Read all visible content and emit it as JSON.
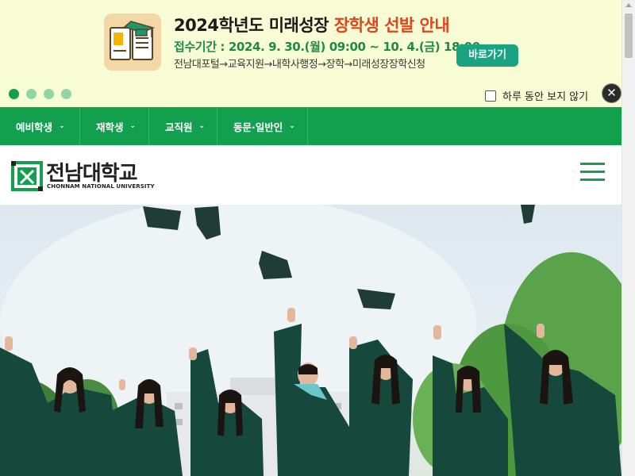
{
  "popup": {
    "title_prefix": "2024학년도 미래성장 ",
    "title_highlight": "장학생 선발 안내",
    "period": "접수기간 : 2024. 9. 30.(월) 09:00 ~  10. 4.(금) 18:00",
    "path": "전남대포털→교육지원→내학사행정→장학→미래성장장학신청",
    "button_label": "바로가기",
    "dismiss_label": "하루 동안 보지 않기",
    "close_icon": "✕",
    "slide_count": 4,
    "active_slide": 1
  },
  "nav": {
    "items": [
      {
        "label": "예비학생",
        "caret": "⌄"
      },
      {
        "label": "재학생",
        "caret": "⌄"
      },
      {
        "label": "교직원",
        "caret": "⌄"
      },
      {
        "label": "동문·일반인",
        "caret": "⌄"
      }
    ]
  },
  "header": {
    "logo_kr": "전남대학교",
    "logo_en": "CHONNAM NATIONAL UNIVERSITY"
  },
  "colors": {
    "brand_green": "#13a04e",
    "highlight_orange": "#e0451c",
    "popup_bg": "#f8fcd4",
    "button_teal": "#19a380"
  }
}
